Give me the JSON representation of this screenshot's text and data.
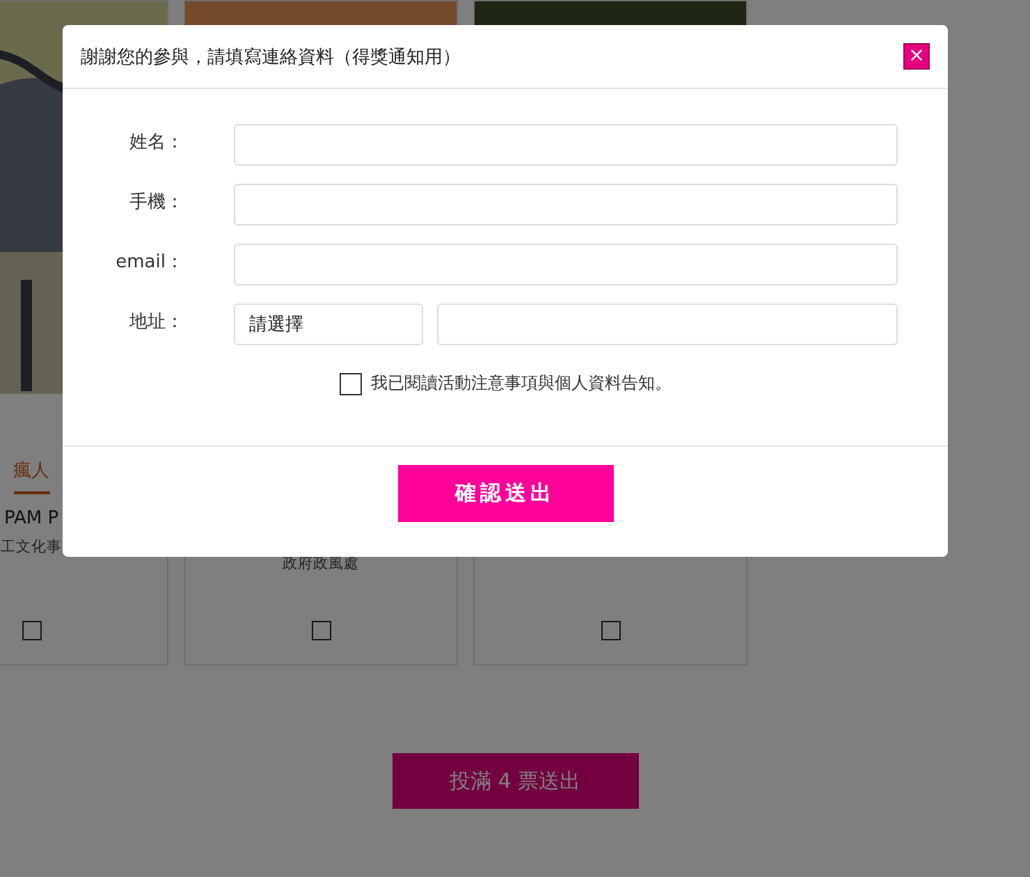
{
  "background": {
    "cards": [
      {
        "title": "瘋人",
        "name": "PAM P",
        "org": "工文化事",
        "checked": false
      },
      {
        "org": "政府政風處",
        "checked": false
      },
      {
        "checked": false
      }
    ],
    "submit_button": "投滿 4 票送出"
  },
  "modal": {
    "title": "謝謝您的參與，請填寫連絡資料（得獎通知用）",
    "close": "×",
    "fields": [
      {
        "label": "姓名：",
        "kind": "text"
      },
      {
        "label": "手機：",
        "kind": "text"
      },
      {
        "label": "email：",
        "kind": "text"
      },
      {
        "label": "地址：",
        "kind": "address",
        "select": "請選擇"
      }
    ],
    "consent": {
      "label": "我已閱讀活動注意事項與個人資料告知。",
      "checked": false
    },
    "confirm_button": "確認送出"
  }
}
